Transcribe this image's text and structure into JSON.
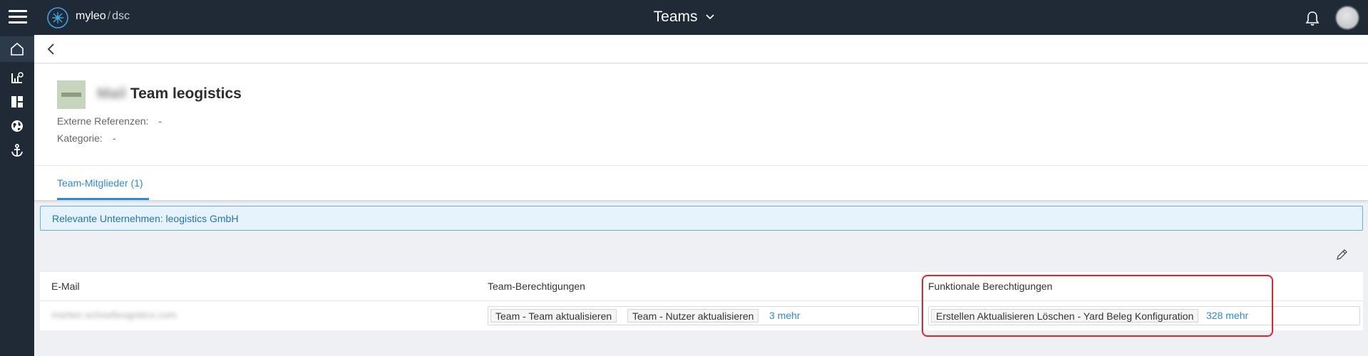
{
  "topbar": {
    "brand": "myleo",
    "brand_sub": "dsc",
    "title": "Teams",
    "icons": [
      "menu-icon",
      "myleo-logo-icon",
      "chevron-down-icon",
      "bell-icon"
    ]
  },
  "sidenav": {
    "items": [
      {
        "icon": "home-icon",
        "active": true
      },
      {
        "icon": "analytics-icon"
      },
      {
        "icon": "dashboard-icon"
      },
      {
        "icon": "globe-icon"
      },
      {
        "icon": "anchor-icon"
      }
    ]
  },
  "header": {
    "team_name_blurred": "Mail",
    "team_name": "Team leogistics",
    "external_refs_label": "Externe Referenzen:",
    "external_refs_value": "-",
    "category_label": "Kategorie:",
    "category_value": "-"
  },
  "tabs": {
    "members": "Team-Mitglieder (1)"
  },
  "banner": {
    "text": "Relevante Unternehmen: leogistics GmbH"
  },
  "table": {
    "columns": [
      "E-Mail",
      "Team-Berechtigungen",
      "Funktionale Berechtigungen"
    ],
    "rows": [
      {
        "email": "marten.schoelleogistics.com",
        "team_permissions": [
          "Team - Team aktualisieren",
          "Team - Nutzer aktualisieren"
        ],
        "team_permissions_more": "3 mehr",
        "functional_permissions": [
          "Erstellen Aktualisieren Löschen - Yard Beleg Konfiguration"
        ],
        "functional_permissions_more": "328 mehr"
      }
    ]
  },
  "colors": {
    "topbar_bg": "#1f2a36",
    "accent": "#2d8ad6",
    "highlight": "#e0242c"
  }
}
